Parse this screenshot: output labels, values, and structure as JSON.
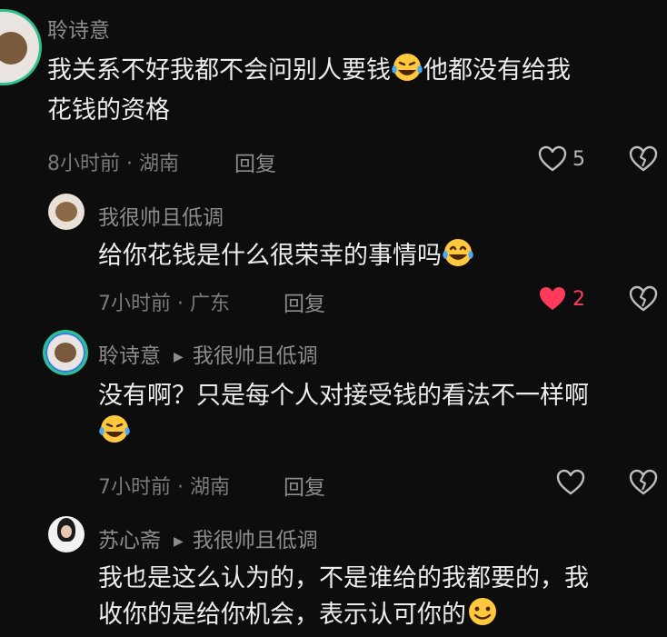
{
  "comments": [
    {
      "user": "聆诗意",
      "text_a": "我关系不好我都不会问别人要钱",
      "text_b": "他都没有给我",
      "text_c": "花钱的资格",
      "meta": "8小时前 · 湖南",
      "reply": "回复",
      "likes": "5",
      "liked": false
    },
    {
      "user": "我很帅且低调",
      "text": "给你花钱是什么很荣幸的事情吗",
      "meta": "7小时前 · 广东",
      "reply": "回复",
      "likes": "2",
      "liked": true
    },
    {
      "user": "聆诗意",
      "reply_to": "我很帅且低调",
      "text": "没有啊？只是每个人对接受钱的看法不一样啊",
      "meta": "7小时前 · 湖南",
      "reply": "回复",
      "likes": "",
      "liked": false
    },
    {
      "user": "苏心斋",
      "reply_to": "我很帅且低调",
      "text_a": "我也是这么认为的，不是谁给的我都要的，我",
      "text_b": "收你的是给你机会，表示认可你的"
    }
  ],
  "colors": {
    "accent_like": "#ff3b5c",
    "ring_gradient_a": "#33c9a0",
    "ring_gradient_b": "#2d7be6"
  },
  "icons": [
    "heart-icon",
    "broken-heart-icon",
    "laughing-crying-emoji",
    "smiling-emoji",
    "reply-arrow-icon"
  ]
}
